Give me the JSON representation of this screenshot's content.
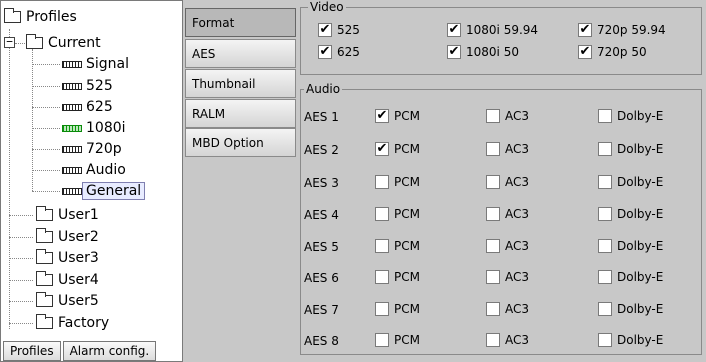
{
  "tree": {
    "root": "Profiles",
    "expander": "−",
    "current": "Current",
    "children": [
      "Signal",
      "525",
      "625",
      "1080i",
      "720p",
      "Audio",
      "General"
    ],
    "users": [
      "User1",
      "User2",
      "User3",
      "User4",
      "User5",
      "Factory"
    ]
  },
  "bottom_buttons": [
    "Profiles",
    "Alarm config."
  ],
  "tabs": [
    "Format",
    "AES",
    "Thumbnail",
    "RALM",
    "MBD Option"
  ],
  "video": {
    "title": "Video",
    "options": [
      {
        "label": "525",
        "checked": true
      },
      {
        "label": "1080i 59.94",
        "checked": true
      },
      {
        "label": "720p 59.94",
        "checked": true
      },
      {
        "label": "625",
        "checked": true
      },
      {
        "label": "1080i 50",
        "checked": true
      },
      {
        "label": "720p 50",
        "checked": true
      }
    ]
  },
  "audio": {
    "title": "Audio",
    "columns": [
      "PCM",
      "AC3",
      "Dolby-E"
    ],
    "rows": [
      {
        "label": "AES 1",
        "values": [
          true,
          false,
          false
        ]
      },
      {
        "label": "AES 2",
        "values": [
          true,
          false,
          false
        ]
      },
      {
        "label": "AES 3",
        "values": [
          false,
          false,
          false
        ]
      },
      {
        "label": "AES 4",
        "values": [
          false,
          false,
          false
        ]
      },
      {
        "label": "AES 5",
        "values": [
          false,
          false,
          false
        ]
      },
      {
        "label": "AES 6",
        "values": [
          false,
          false,
          false
        ]
      },
      {
        "label": "AES 7",
        "values": [
          false,
          false,
          false
        ]
      },
      {
        "label": "AES 8",
        "values": [
          false,
          false,
          false
        ]
      }
    ]
  },
  "check_mark": "✔"
}
